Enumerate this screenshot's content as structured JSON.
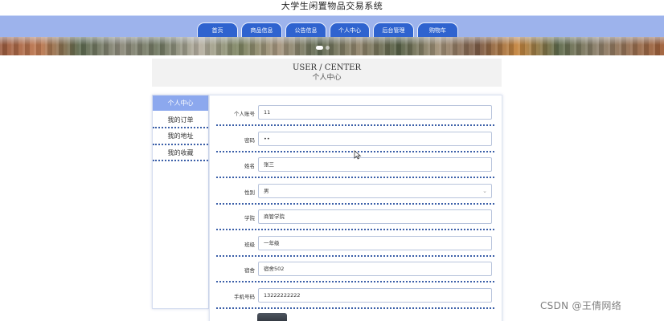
{
  "site": {
    "title": "大学生闲置物品交易系统"
  },
  "nav": {
    "items": [
      {
        "label": "首页"
      },
      {
        "label": "商品信息"
      },
      {
        "label": "公告信息"
      },
      {
        "label": "个人中心"
      },
      {
        "label": "后台管理"
      },
      {
        "label": "购物车"
      }
    ]
  },
  "banner": {
    "slide_count": 2,
    "active_slide": 1
  },
  "center": {
    "title_en": "USER / CENTER",
    "title_cn": "个人中心"
  },
  "side_menu": {
    "items": [
      {
        "label": "个人中心",
        "active": true
      },
      {
        "label": "我的订单",
        "active": false
      },
      {
        "label": "我的地址",
        "active": false
      },
      {
        "label": "我的收藏",
        "active": false
      }
    ]
  },
  "form": {
    "fields": [
      {
        "label": "个人账号",
        "value": "11"
      },
      {
        "label": "密码",
        "value": "••"
      },
      {
        "label": "姓名",
        "value": "张三"
      },
      {
        "label": "性别",
        "value": "男",
        "type": "select"
      },
      {
        "label": "学院",
        "value": "商管学院"
      },
      {
        "label": "班级",
        "value": "一年级"
      },
      {
        "label": "宿舍",
        "value": "宿舍502"
      },
      {
        "label": "手机号码",
        "value": "13222222222"
      }
    ]
  },
  "colors": {
    "nav_bar": "#9db3ec",
    "nav_tab": "#2f63cf",
    "side_active": "#8ca8ee",
    "divider": "#3b5fa8"
  },
  "icons": {
    "select_chevron": "chevron-down-icon",
    "cursor": "mouse-pointer-icon"
  },
  "watermark": "CSDN @王倩网络"
}
